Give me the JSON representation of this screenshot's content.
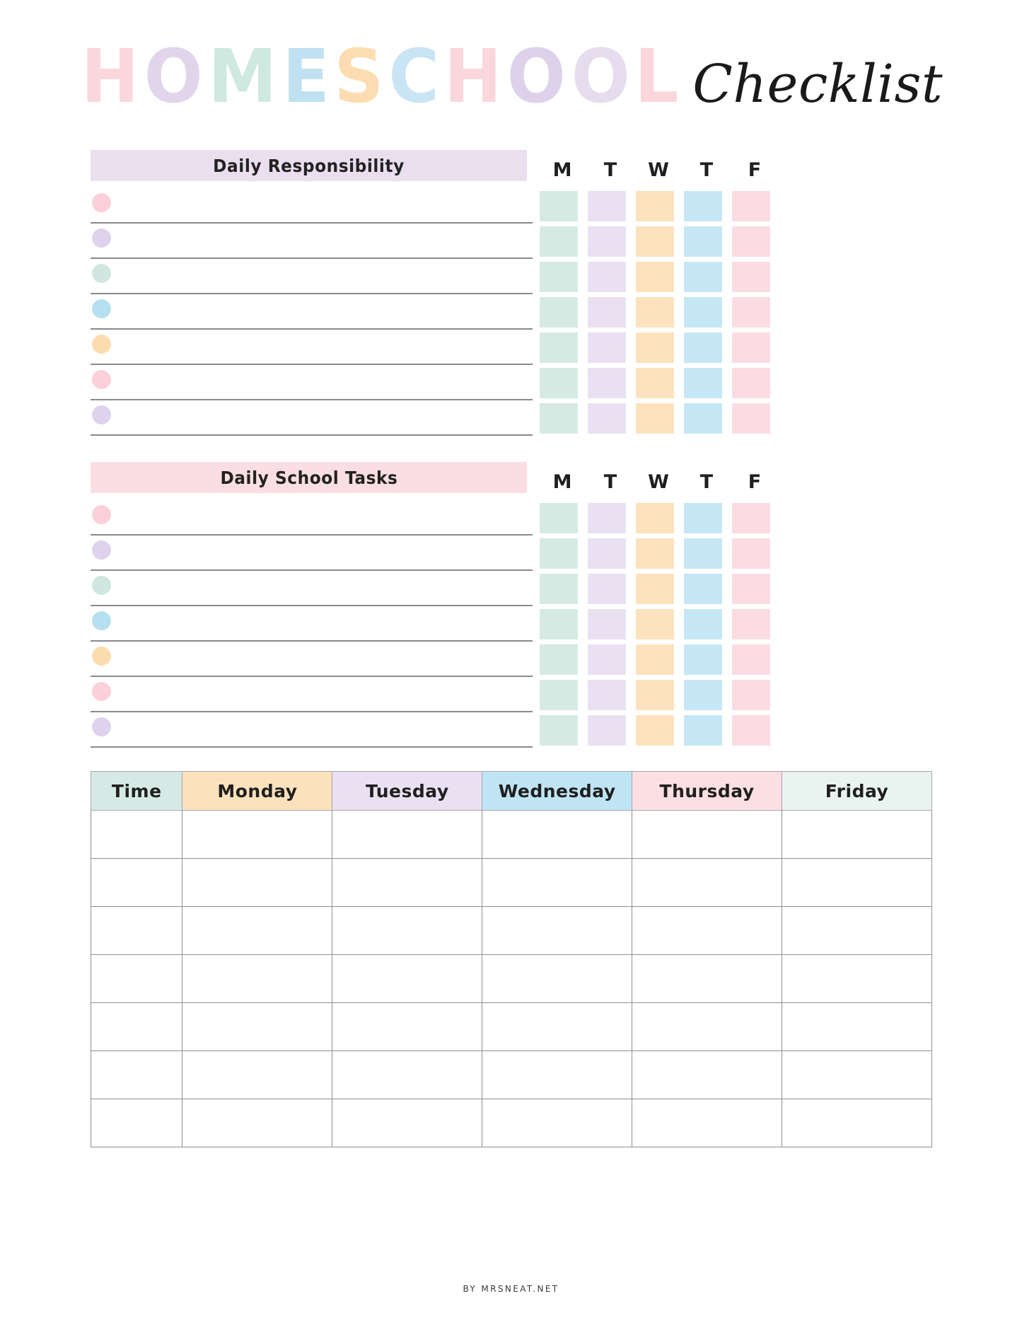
{
  "title": {
    "main_word": "HOMESCHOOL",
    "letters": [
      {
        "char": "H",
        "color": "#fad6dd"
      },
      {
        "char": "O",
        "color": "#e1d5ec"
      },
      {
        "char": "M",
        "color": "#cfe9e1"
      },
      {
        "char": "E",
        "color": "#bfe1f2"
      },
      {
        "char": "S",
        "color": "#fcdcb0"
      },
      {
        "char": "C",
        "color": "#c9e4f5"
      },
      {
        "char": "H",
        "color": "#fad6dd"
      },
      {
        "char": "O",
        "color": "#ded2ea"
      },
      {
        "char": "O",
        "color": "#e5dced"
      },
      {
        "char": "L",
        "color": "#fad6dd"
      }
    ],
    "script_word": "Checklist"
  },
  "sections": [
    {
      "name": "daily-responsibility",
      "header_label": "Daily Responsibility",
      "header_color": "#e9dfee",
      "day_headers": [
        "M",
        "T",
        "W",
        "T",
        "F"
      ],
      "row_count": 7,
      "rows": [
        {
          "text": "",
          "dot_color": "#fbd0da"
        },
        {
          "text": "",
          "dot_color": "#dfd2ec"
        },
        {
          "text": "",
          "dot_color": "#cfe7e0"
        },
        {
          "text": "",
          "dot_color": "#b6e0f0"
        },
        {
          "text": "",
          "dot_color": "#fcdcae"
        },
        {
          "text": "",
          "dot_color": "#fbd0da"
        },
        {
          "text": "",
          "dot_color": "#dfd2ec"
        }
      ],
      "column_colors": [
        "#d6eae4",
        "#e9e1f1",
        "#fce2bd",
        "#c6e7f5",
        "#fbdce3"
      ]
    },
    {
      "name": "daily-school-tasks",
      "header_label": "Daily School Tasks",
      "header_color": "#fbdee3",
      "day_headers": [
        "M",
        "T",
        "W",
        "T",
        "F"
      ],
      "row_count": 7,
      "rows": [
        {
          "text": "",
          "dot_color": "#fbd0da"
        },
        {
          "text": "",
          "dot_color": "#dfd2ec"
        },
        {
          "text": "",
          "dot_color": "#cfe7e0"
        },
        {
          "text": "",
          "dot_color": "#b6e0f0"
        },
        {
          "text": "",
          "dot_color": "#fcdcae"
        },
        {
          "text": "",
          "dot_color": "#fbd0da"
        },
        {
          "text": "",
          "dot_color": "#dfd2ec"
        }
      ],
      "column_colors": [
        "#d6eae4",
        "#e9e1f1",
        "#fce2bd",
        "#c6e7f5",
        "#fbdce3"
      ]
    }
  ],
  "schedule": {
    "columns": [
      {
        "label": "Time",
        "color": "#d5eae5"
      },
      {
        "label": "Monday",
        "color": "#fce2bc"
      },
      {
        "label": "Tuesday",
        "color": "#e9e1f1"
      },
      {
        "label": "Wednesday",
        "color": "#bfe5f5"
      },
      {
        "label": "Thursday",
        "color": "#fbdfe3"
      },
      {
        "label": "Friday",
        "color": "#e9f3f0"
      }
    ],
    "body_row_count": 7,
    "rows": [
      [
        "",
        "",
        "",
        "",
        "",
        ""
      ],
      [
        "",
        "",
        "",
        "",
        "",
        ""
      ],
      [
        "",
        "",
        "",
        "",
        "",
        ""
      ],
      [
        "",
        "",
        "",
        "",
        "",
        ""
      ],
      [
        "",
        "",
        "",
        "",
        "",
        ""
      ],
      [
        "",
        "",
        "",
        "",
        "",
        ""
      ],
      [
        "",
        "",
        "",
        "",
        "",
        ""
      ]
    ]
  },
  "footer": {
    "credit": "BY MRSNEAT.NET"
  }
}
